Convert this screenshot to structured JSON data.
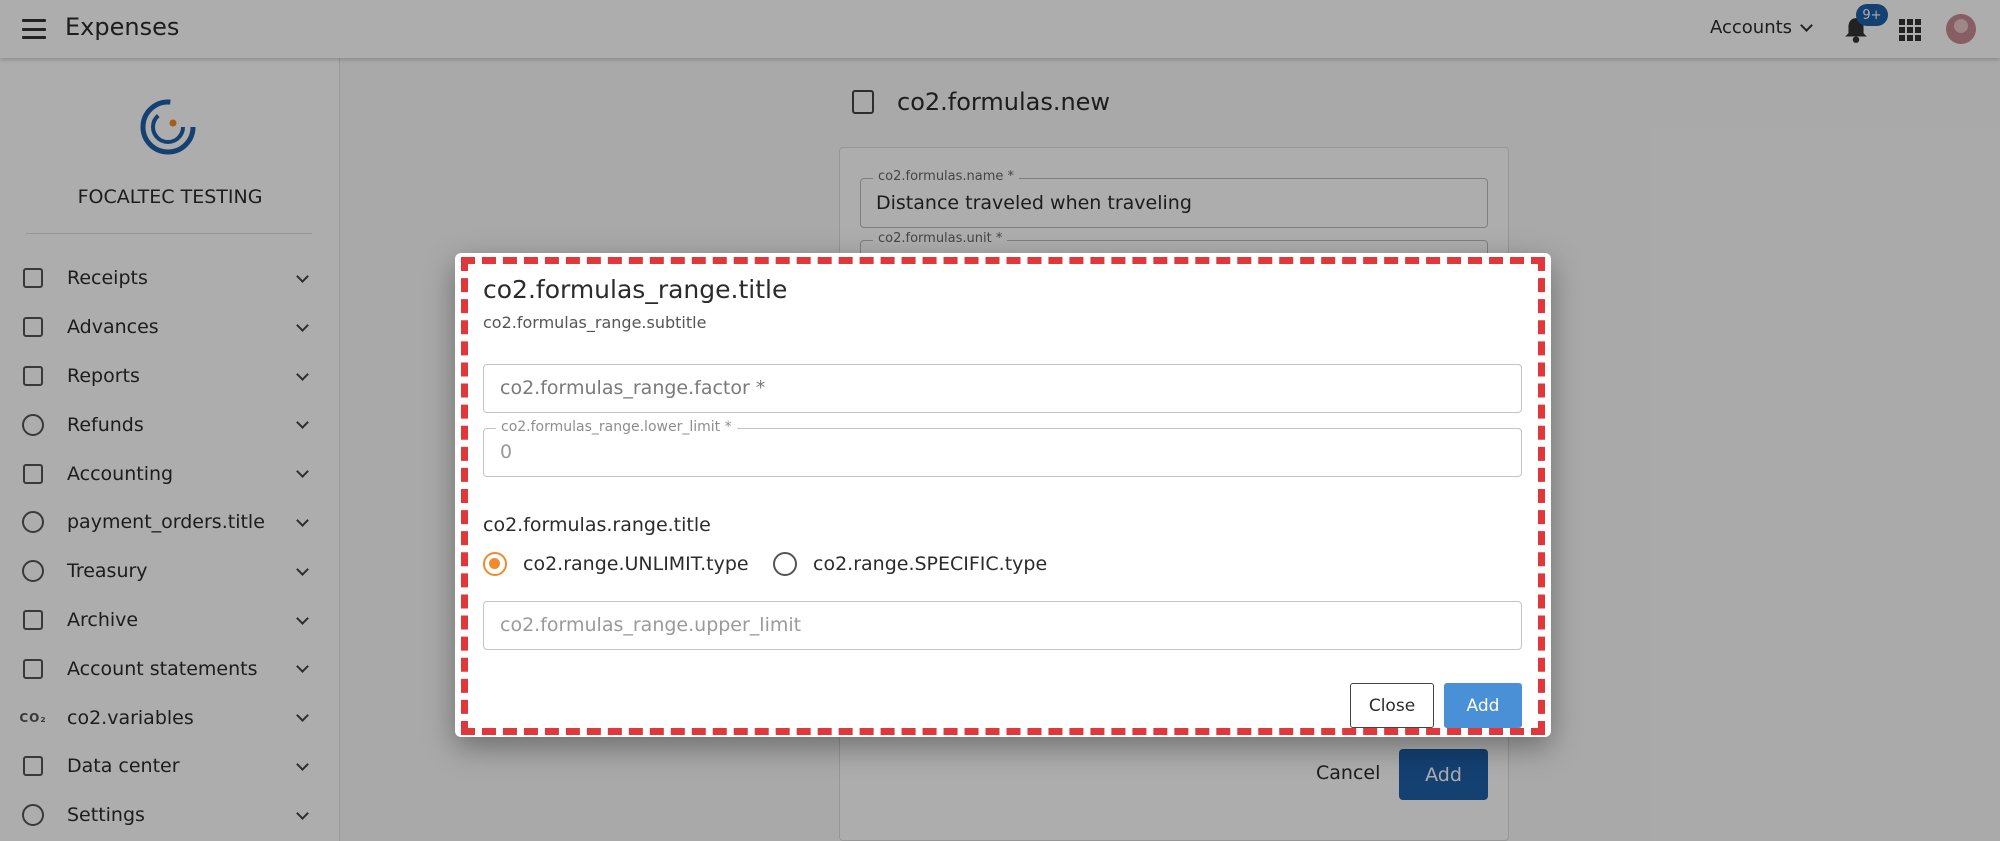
{
  "header": {
    "title": "Expenses",
    "accounts_label": "Accounts",
    "notifications_badge": "9+"
  },
  "sidebar": {
    "org_name": "FOCALTEC TESTING",
    "items": [
      {
        "label": "Receipts",
        "icon": "receipt-icon"
      },
      {
        "label": "Advances",
        "icon": "money-icon"
      },
      {
        "label": "Reports",
        "icon": "report-icon"
      },
      {
        "label": "Refunds",
        "icon": "refund-icon"
      },
      {
        "label": "Accounting",
        "icon": "bank-icon"
      },
      {
        "label": "payment_orders.title",
        "icon": "coins-icon"
      },
      {
        "label": "Treasury",
        "icon": "piggy-bank-icon"
      },
      {
        "label": "Archive",
        "icon": "archive-icon"
      },
      {
        "label": "Account statements",
        "icon": "wallet-icon"
      },
      {
        "label": "co2.variables",
        "icon": "co2-icon"
      },
      {
        "label": "Data center",
        "icon": "data-center-icon"
      },
      {
        "label": "Settings",
        "icon": "gear-icon"
      }
    ]
  },
  "page": {
    "title": "co2.formulas.new",
    "name_label": "co2.formulas.name *",
    "name_value": "Distance traveled when traveling",
    "unit_label": "co2.formulas.unit *",
    "cancel_label": "Cancel",
    "add_label": "Add"
  },
  "dialog": {
    "title": "co2.formulas_range.title",
    "subtitle": "co2.formulas_range.subtitle",
    "factor_placeholder": "co2.formulas_range.factor *",
    "lower_limit_label": "co2.formulas_range.lower_limit *",
    "lower_limit_value": "0",
    "range_section_title": "co2.formulas.range.title",
    "radio_unlimit": "co2.range.UNLIMIT.type",
    "radio_specific": "co2.range.SPECIFIC.type",
    "upper_limit_placeholder": "co2.formulas_range.upper_limit",
    "close_label": "Close",
    "add_label": "Add"
  },
  "colors": {
    "accent_orange": "#ef8b2c",
    "primary_blue": "#1e5fa8",
    "dialog_add_blue": "#4a90d6",
    "highlight_red": "#e0383a"
  }
}
